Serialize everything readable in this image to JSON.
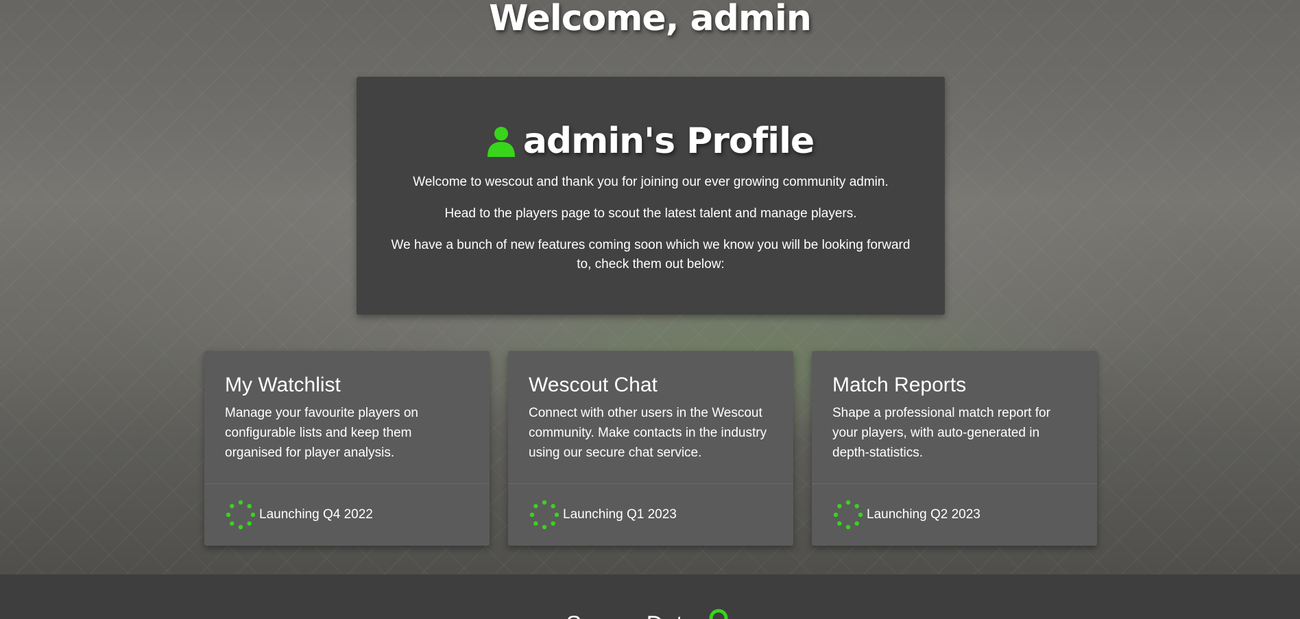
{
  "welcome": {
    "title": "Welcome, admin"
  },
  "profile": {
    "title": "admin's Profile",
    "icon": "user-icon",
    "p1": "Welcome to wescout and thank you for joining our ever growing community admin.",
    "p2": "Head to the players page to scout the latest talent and manage players.",
    "p3": "We have a bunch of new features coming soon which we know you will be looking forward to, check them out below:"
  },
  "cards": [
    {
      "title": "My Watchlist",
      "text": "Manage your favourite players on configurable lists and keep them organised for player analysis.",
      "status": "Launching Q4 2022"
    },
    {
      "title": "Wescout Chat",
      "text": "Connect with other users in the Wescout community. Make contacts in the industry using our secure chat service.",
      "status": "Launching Q1 2023"
    },
    {
      "title": "Match Reports",
      "text": "Shape a professional match report for your players, with auto-generated in depth-statistics.",
      "status": "Launching Q2 2023"
    }
  ],
  "footer": {
    "title": "Secure Data",
    "icon": "lock-icon"
  },
  "colors": {
    "accent": "#39d41c",
    "panel": "#424242",
    "card": "#5b5b5b",
    "footer": "#3e3e3e"
  }
}
